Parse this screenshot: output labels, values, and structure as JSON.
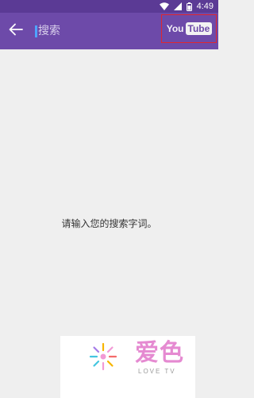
{
  "status_bar": {
    "time": "4:49"
  },
  "app_bar": {
    "search_placeholder": "搜索",
    "youtube_logo": {
      "you": "You",
      "tube": "Tube"
    }
  },
  "content": {
    "empty_message": "请输入您的搜索字词。"
  },
  "watermark": {
    "title": "爱色",
    "subtitle": "LOVE TV"
  },
  "colors": {
    "status_bar": "#5b3a95",
    "app_bar": "#6d4aa9",
    "background": "#efefef",
    "highlight_border": "#e0262f",
    "cursor": "#4ea3ff"
  }
}
